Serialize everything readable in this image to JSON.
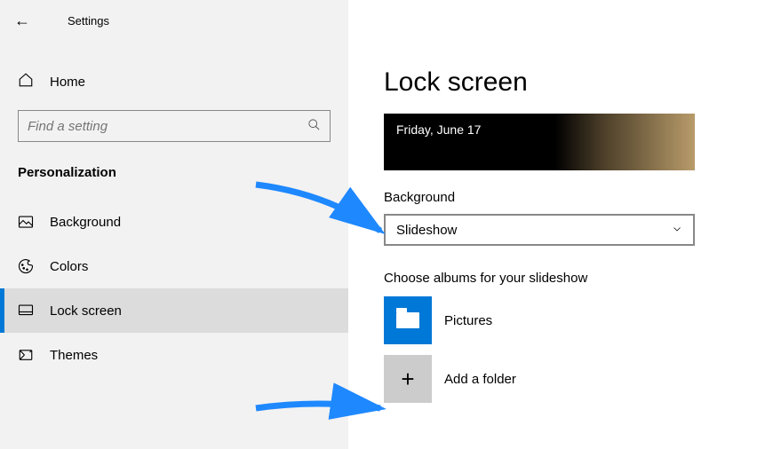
{
  "app_title": "Settings",
  "home_label": "Home",
  "search_placeholder": "Find a setting",
  "section_header": "Personalization",
  "nav": [
    {
      "label": "Background"
    },
    {
      "label": "Colors"
    },
    {
      "label": "Lock screen"
    },
    {
      "label": "Themes"
    }
  ],
  "main": {
    "title": "Lock screen",
    "preview_date": "Friday, June 17",
    "background_label": "Background",
    "background_value": "Slideshow",
    "albums_label": "Choose albums for your slideshow",
    "album0": "Pictures",
    "add_folder_label": "Add a folder"
  }
}
